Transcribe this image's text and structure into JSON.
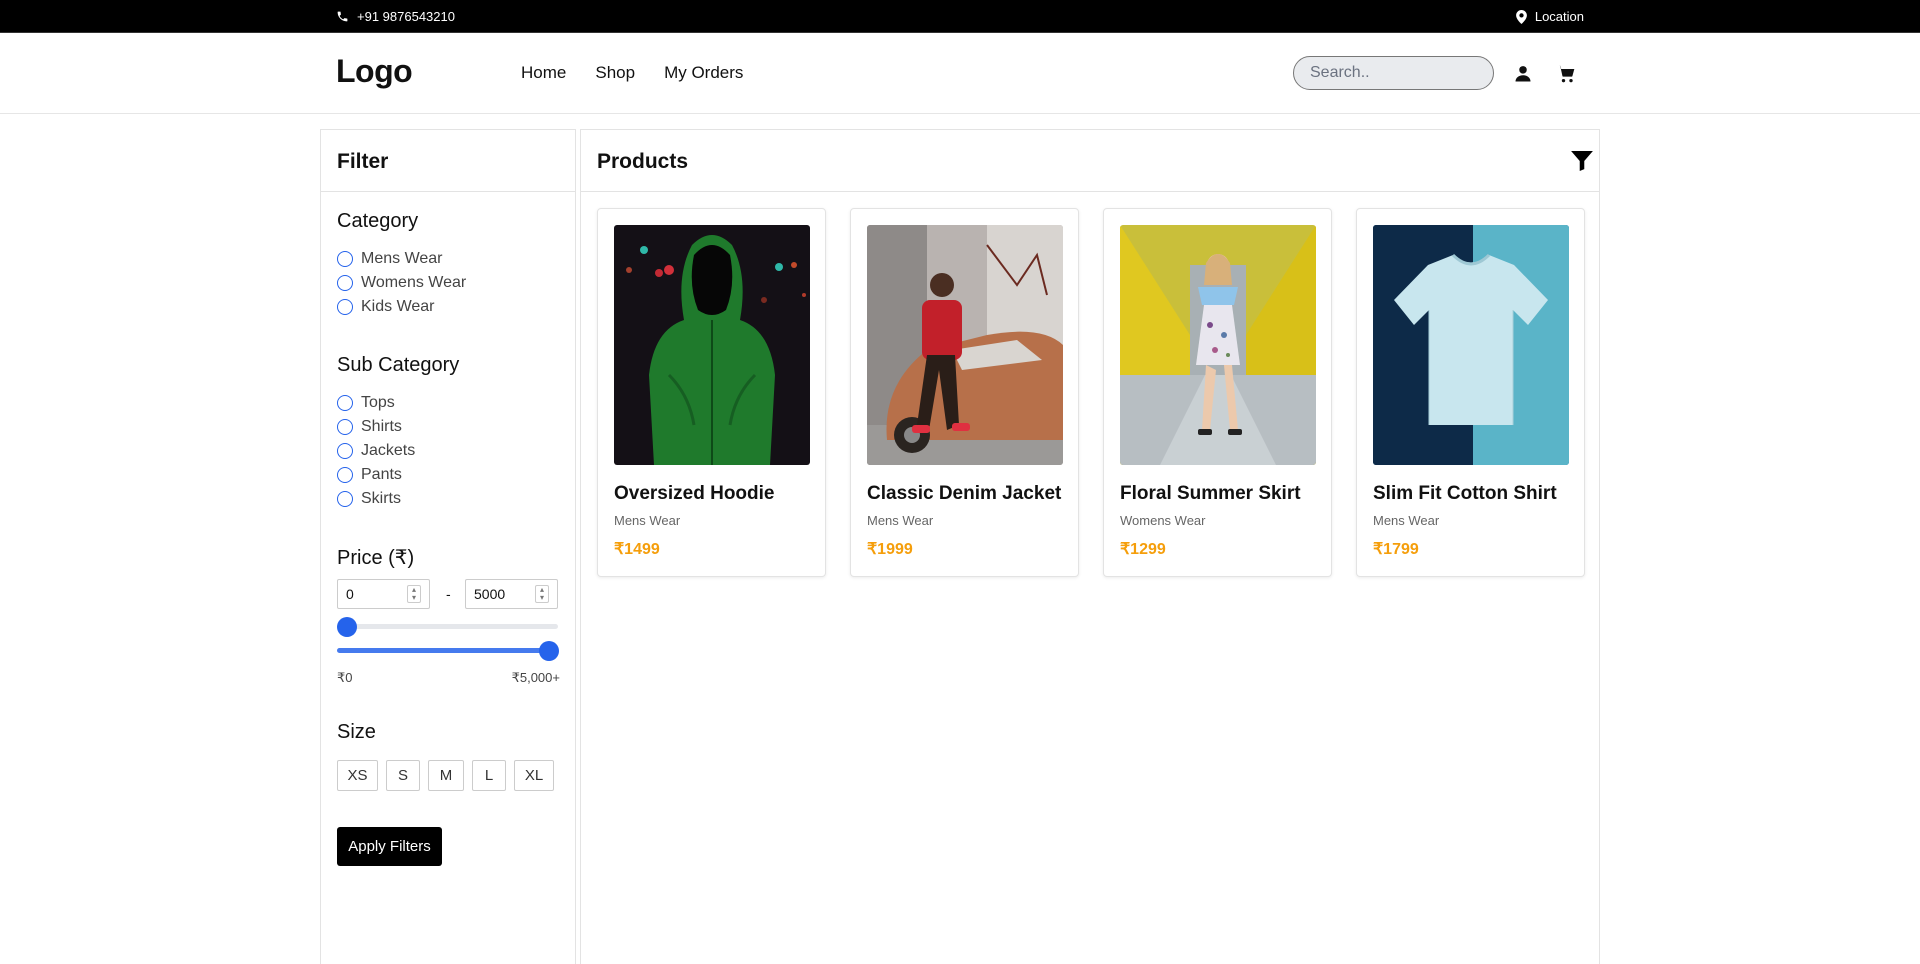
{
  "topbar": {
    "phone": "+91 9876543210",
    "location": "Location"
  },
  "header": {
    "logo": "Logo",
    "nav": [
      "Home",
      "Shop",
      "My Orders"
    ],
    "search_placeholder": "Search.."
  },
  "filter": {
    "title": "Filter",
    "category": {
      "title": "Category",
      "options": [
        "Mens Wear",
        "Womens Wear",
        "Kids Wear"
      ]
    },
    "sub_category": {
      "title": "Sub Category",
      "options": [
        "Tops",
        "Shirts",
        "Jackets",
        "Pants",
        "Skirts"
      ]
    },
    "price": {
      "title": "Price (₹)",
      "min_value": "0",
      "max_value": "5000",
      "separator": "-",
      "range_min_label": "₹0",
      "range_max_label": "₹5,000+"
    },
    "size": {
      "title": "Size",
      "options": [
        "XS",
        "S",
        "M",
        "L",
        "XL"
      ]
    },
    "apply_label": "Apply Filters"
  },
  "products": {
    "title": "Products",
    "items": [
      {
        "name": "Oversized Hoodie",
        "category": "Mens Wear",
        "price": "₹1499"
      },
      {
        "name": "Classic Denim Jacket",
        "category": "Mens Wear",
        "price": "₹1999"
      },
      {
        "name": "Floral Summer Skirt",
        "category": "Womens Wear",
        "price": "₹1299"
      },
      {
        "name": "Slim Fit Cotton Shirt",
        "category": "Mens Wear",
        "price": "₹1799"
      }
    ]
  },
  "colors": {
    "accent": "#2563eb",
    "price": "#f59e0b",
    "topbar": "#000000"
  }
}
